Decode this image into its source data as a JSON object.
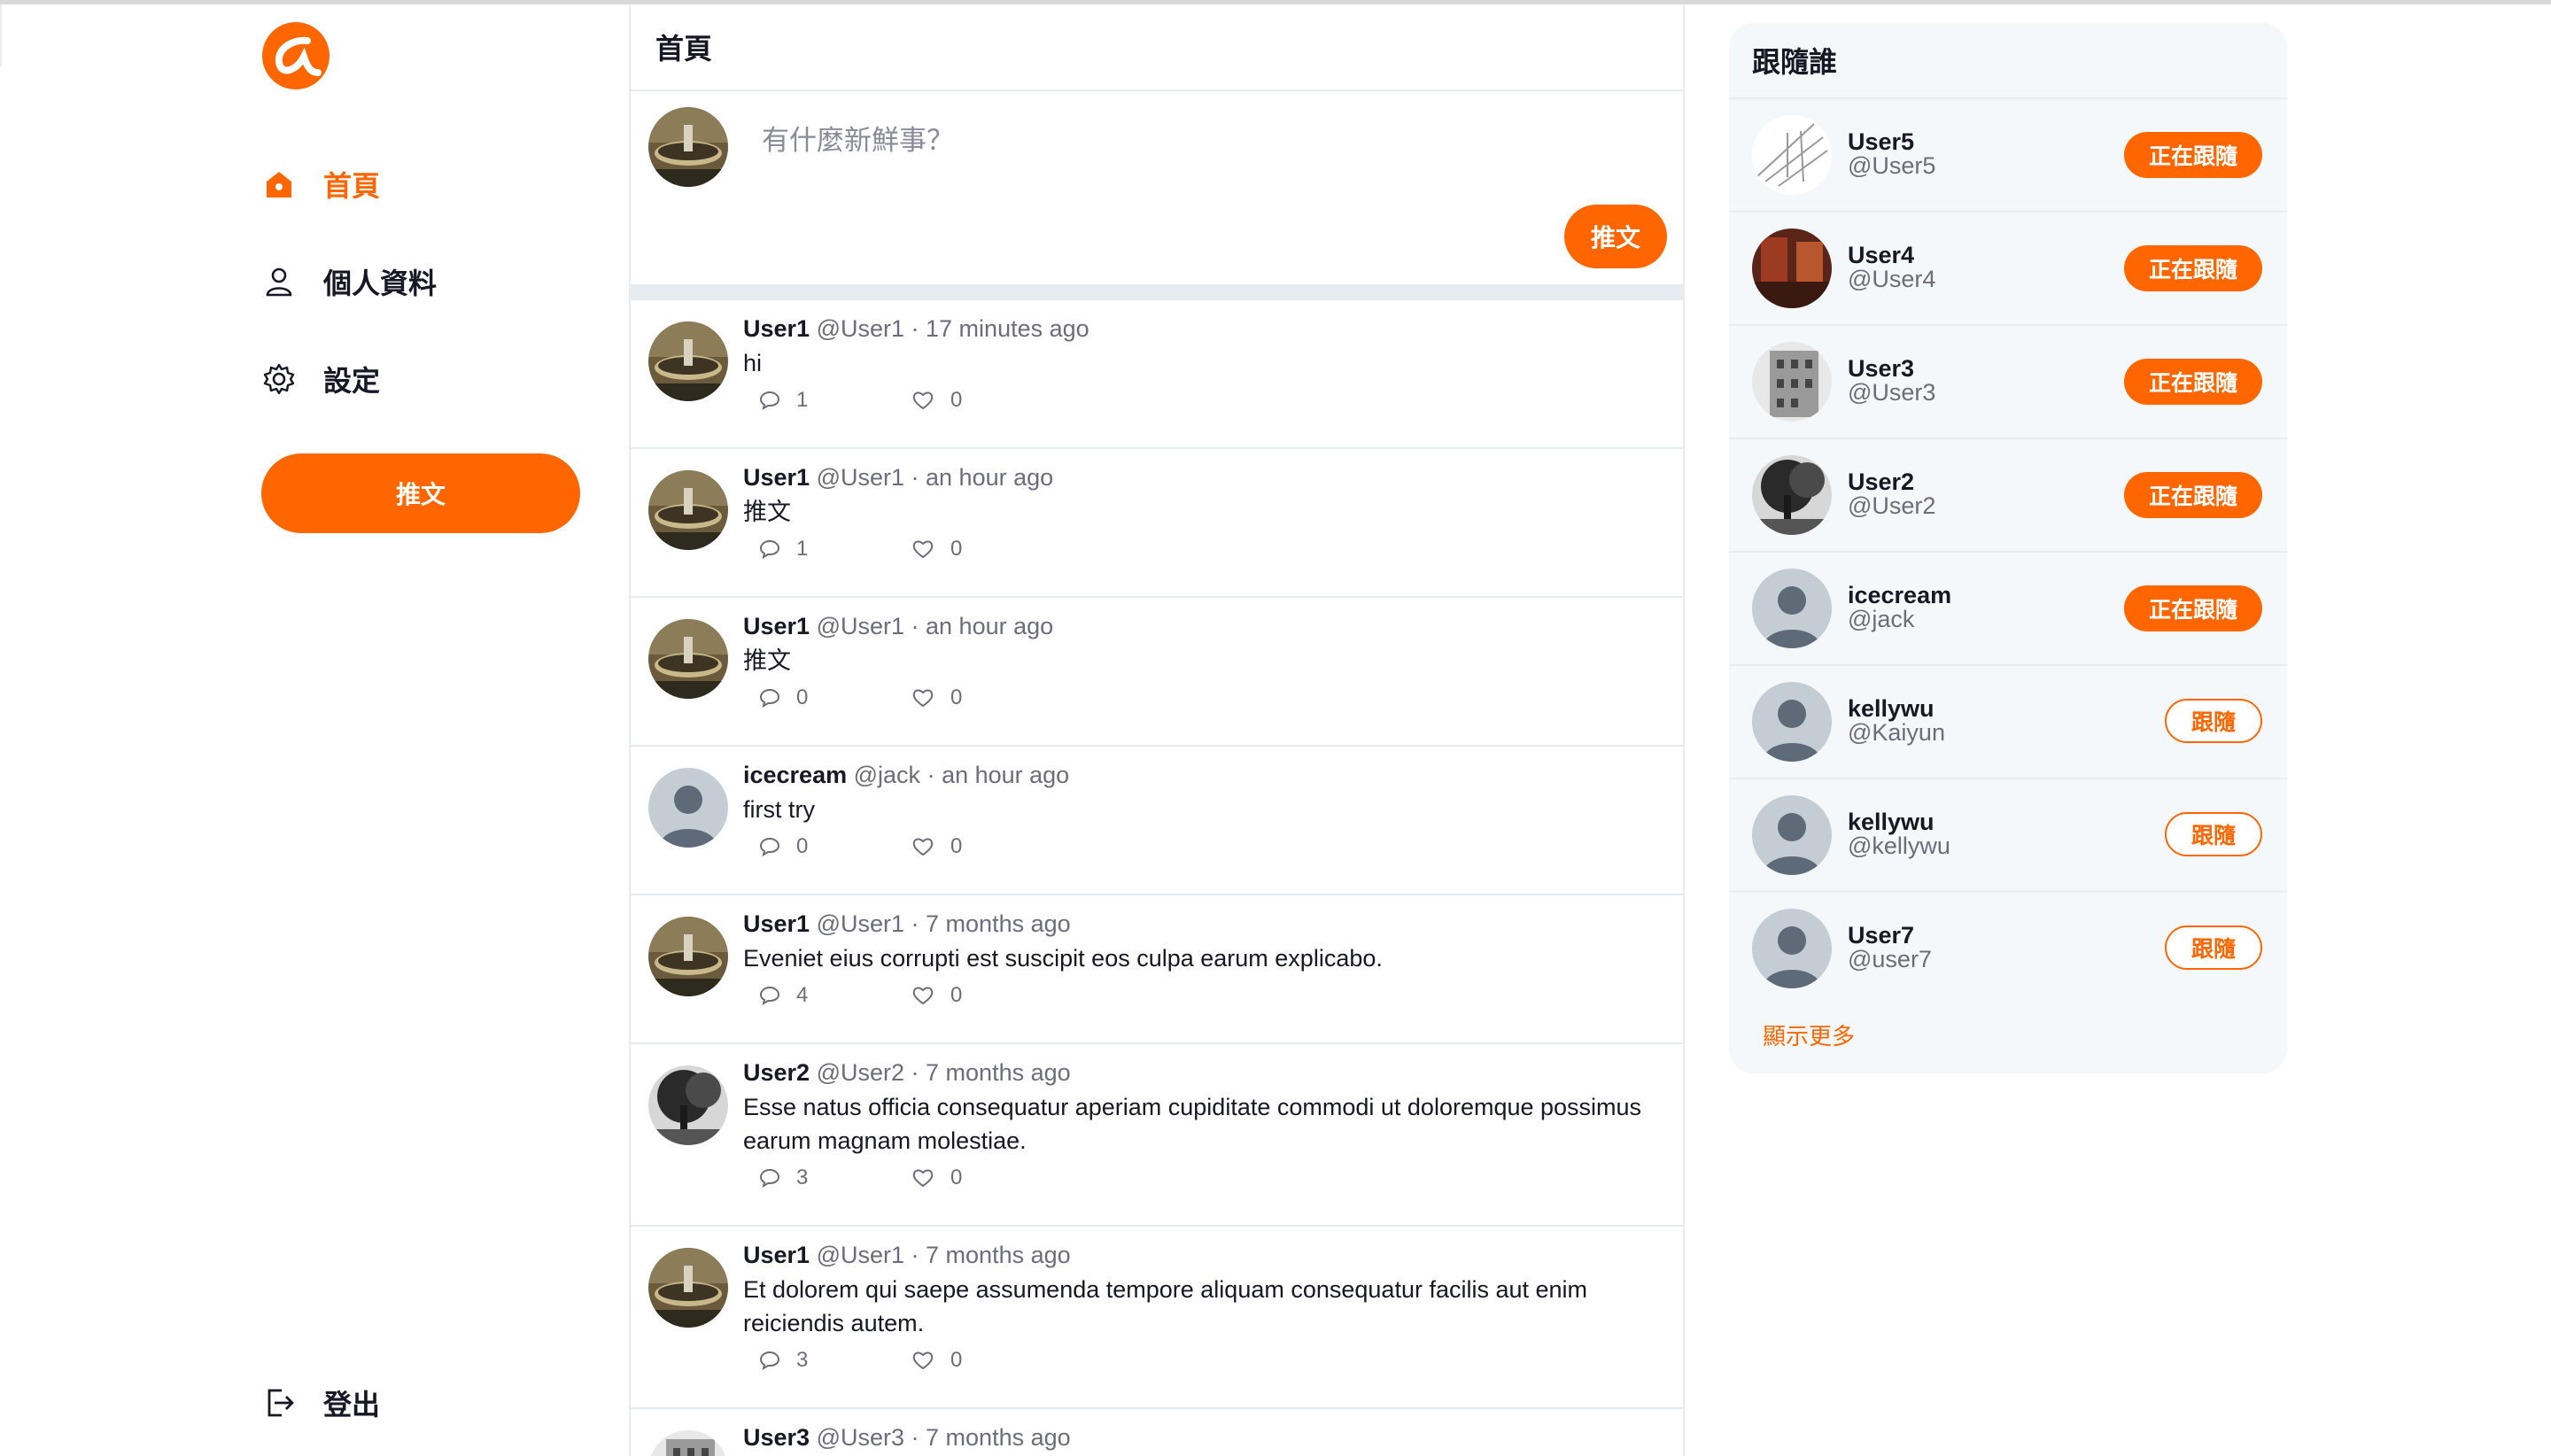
{
  "brand": {
    "accent": "#FF6600",
    "name": "logo"
  },
  "nav": {
    "items": [
      {
        "label": "首頁",
        "icon": "home-icon",
        "active": true
      },
      {
        "label": "個人資料",
        "icon": "user-icon",
        "active": false
      },
      {
        "label": "設定",
        "icon": "gear-icon",
        "active": false
      }
    ],
    "tweet_button": "推文",
    "logout": "登出"
  },
  "main": {
    "title": "首頁",
    "composer": {
      "placeholder": "有什麼新鮮事？",
      "submit": "推文"
    },
    "tweets": [
      {
        "name": "User1",
        "handle": "@User1",
        "time": "· 17 minutes ago",
        "text": "hi",
        "replies": "1",
        "likes": "0",
        "avatar": "fountain"
      },
      {
        "name": "User1",
        "handle": "@User1",
        "time": "· an hour ago",
        "text": "推文",
        "replies": "1",
        "likes": "0",
        "avatar": "fountain"
      },
      {
        "name": "User1",
        "handle": "@User1",
        "time": "· an hour ago",
        "text": "推文",
        "replies": "0",
        "likes": "0",
        "avatar": "fountain"
      },
      {
        "name": "icecream",
        "handle": "@jack",
        "time": "· an hour ago",
        "text": "first try",
        "replies": "0",
        "likes": "0",
        "avatar": "default"
      },
      {
        "name": "User1",
        "handle": "@User1",
        "time": "· 7 months ago",
        "text": "Eveniet eius corrupti est suscipit eos culpa earum explicabo.",
        "replies": "4",
        "likes": "0",
        "avatar": "fountain"
      },
      {
        "name": "User2",
        "handle": "@User2",
        "time": "· 7 months ago",
        "text": "Esse natus officia consequatur aperiam cupiditate commodi ut doloremque possimus earum magnam molestiae.",
        "replies": "3",
        "likes": "0",
        "avatar": "tree"
      },
      {
        "name": "User1",
        "handle": "@User1",
        "time": "· 7 months ago",
        "text": "Et dolorem qui saepe assumenda tempore aliquam consequatur facilis aut enim reiciendis autem.",
        "replies": "3",
        "likes": "0",
        "avatar": "fountain"
      },
      {
        "name": "User3",
        "handle": "@User3",
        "time": "· 7 months ago",
        "text": "",
        "replies": "",
        "likes": "",
        "avatar": "building"
      }
    ]
  },
  "sidebar": {
    "title": "跟隨誰",
    "users": [
      {
        "name": "User5",
        "handle": "@User5",
        "button": "正在跟隨",
        "following": true,
        "avatar": "sketch"
      },
      {
        "name": "User4",
        "handle": "@User4",
        "button": "正在跟隨",
        "following": true,
        "avatar": "red"
      },
      {
        "name": "User3",
        "handle": "@User3",
        "button": "正在跟隨",
        "following": true,
        "avatar": "building"
      },
      {
        "name": "User2",
        "handle": "@User2",
        "button": "正在跟隨",
        "following": true,
        "avatar": "tree"
      },
      {
        "name": "icecream",
        "handle": "@jack",
        "button": "正在跟隨",
        "following": true,
        "avatar": "default"
      },
      {
        "name": "kellywu",
        "handle": "@Kaiyun",
        "button": "跟隨",
        "following": false,
        "avatar": "default"
      },
      {
        "name": "kellywu",
        "handle": "@kellywu",
        "button": "跟隨",
        "following": false,
        "avatar": "default"
      },
      {
        "name": "User7",
        "handle": "@user7",
        "button": "跟隨",
        "following": false,
        "avatar": "default"
      }
    ],
    "show_more": "顯示更多"
  }
}
